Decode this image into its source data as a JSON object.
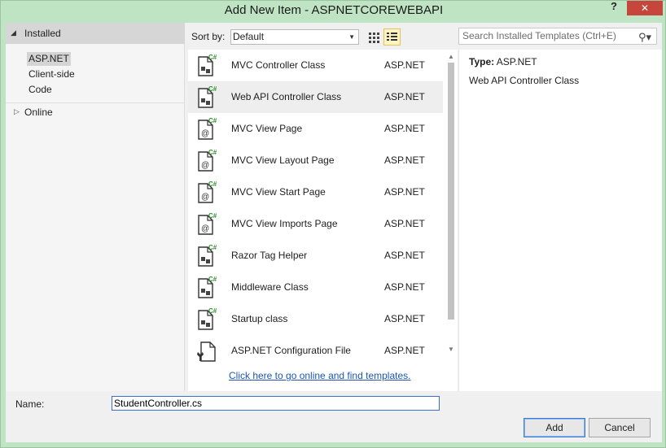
{
  "window": {
    "title": "Add New Item - ASPNETCOREWEBAPI",
    "help_label": "?",
    "close_label": "✕"
  },
  "tree": {
    "installed_label": "Installed",
    "items": [
      {
        "label": "ASP.NET",
        "selected": true
      },
      {
        "label": "Client-side",
        "selected": false
      },
      {
        "label": "Code",
        "selected": false
      }
    ],
    "online_label": "Online"
  },
  "toolbar": {
    "sort_label": "Sort by:",
    "sort_value": "Default",
    "search_placeholder": "Search Installed Templates (Ctrl+E)"
  },
  "templates": [
    {
      "name": "MVC Controller Class",
      "type": "ASP.NET",
      "icon": "csharp-class-icon",
      "selected": false
    },
    {
      "name": "Web API Controller Class",
      "type": "ASP.NET",
      "icon": "csharp-class-icon",
      "selected": true
    },
    {
      "name": "MVC View Page",
      "type": "ASP.NET",
      "icon": "razor-page-icon",
      "selected": false
    },
    {
      "name": "MVC View Layout Page",
      "type": "ASP.NET",
      "icon": "razor-page-icon",
      "selected": false
    },
    {
      "name": "MVC View Start Page",
      "type": "ASP.NET",
      "icon": "razor-page-icon",
      "selected": false
    },
    {
      "name": "MVC View Imports Page",
      "type": "ASP.NET",
      "icon": "razor-page-icon",
      "selected": false
    },
    {
      "name": "Razor Tag Helper",
      "type": "ASP.NET",
      "icon": "csharp-class-icon",
      "selected": false
    },
    {
      "name": "Middleware Class",
      "type": "ASP.NET",
      "icon": "csharp-class-icon",
      "selected": false
    },
    {
      "name": "Startup class",
      "type": "ASP.NET",
      "icon": "csharp-class-icon",
      "selected": false
    },
    {
      "name": "ASP.NET Configuration File",
      "type": "ASP.NET",
      "icon": "config-file-icon",
      "selected": false
    }
  ],
  "online_link": "Click here to go online and find templates.",
  "details": {
    "type_label": "Type:",
    "type_value": "ASP.NET",
    "description": "Web API Controller Class"
  },
  "name_field": {
    "label": "Name:",
    "value": "StudentController.cs"
  },
  "buttons": {
    "add": "Add",
    "cancel": "Cancel"
  },
  "colors": {
    "frame": "#bfe4c4",
    "close": "#c7463b",
    "link": "#1e55b5",
    "csharp_badge": "#2e8b2e"
  }
}
